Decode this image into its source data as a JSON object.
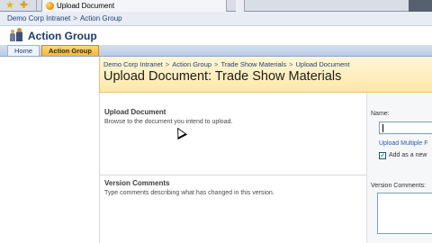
{
  "browser": {
    "tab_title": "Upload Document",
    "icons": [
      "favorites-star-icon",
      "add-favorite-icon",
      "page-icon"
    ]
  },
  "top_breadcrumb": [
    "Demo Corp Intranet",
    "Action Group"
  ],
  "top_breadcrumb_sep": ">",
  "site": {
    "title": "Action Group",
    "icon": "people-icon"
  },
  "nav": {
    "tabs": [
      {
        "label": "Home",
        "active": false
      },
      {
        "label": "Action Group",
        "active": true
      }
    ]
  },
  "page": {
    "breadcrumb": [
      "Demo Corp Intranet",
      "Action Group",
      "Trade Show Materials",
      "Upload Document"
    ],
    "breadcrumb_sep": ">",
    "title": "Upload Document: Trade Show Materials"
  },
  "form": {
    "upload_section": {
      "title": "Upload Document",
      "description": "Browse to the document you intend to upload."
    },
    "version_section": {
      "title": "Version Comments",
      "description": "Type comments describing what has changed in this version."
    },
    "name_label": "Name:",
    "name_value": "",
    "upload_multiple_link": "Upload Multiple F",
    "add_as_new_label": "Add as a new",
    "add_as_new_checked": true,
    "version_comments_label": "Version Comments:"
  },
  "colors": {
    "title_band": "#fde7a9",
    "link": "#22427b",
    "active_tab": "#f7b733"
  }
}
